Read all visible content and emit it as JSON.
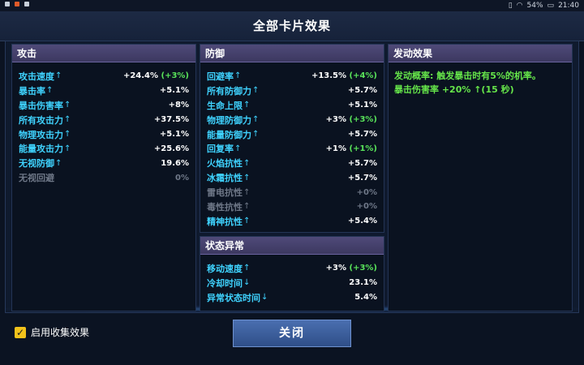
{
  "status_bar": {
    "right_text": "54%",
    "time": "21:40"
  },
  "dialog_title": "全部卡片效果",
  "attack": {
    "header": "攻击",
    "rows": [
      {
        "label": "攻击速度",
        "arrow": "↑",
        "value": "+24.4%",
        "bonus": "(+3%)"
      },
      {
        "label": "暴击率",
        "arrow": "↑",
        "value": "+5.1%",
        "bonus": ""
      },
      {
        "label": "暴击伤害率",
        "arrow": "↑",
        "value": "+8%",
        "bonus": ""
      },
      {
        "label": "所有攻击力",
        "arrow": "↑",
        "value": "+37.5%",
        "bonus": ""
      },
      {
        "label": "物理攻击力",
        "arrow": "↑",
        "value": "+5.1%",
        "bonus": ""
      },
      {
        "label": "能量攻击力",
        "arrow": "↑",
        "value": "+25.6%",
        "bonus": ""
      },
      {
        "label": "无视防御",
        "arrow": "↑",
        "value": "19.6%",
        "bonus": ""
      },
      {
        "label": "无视回避",
        "arrow": "",
        "value": "0%",
        "bonus": "",
        "dim": true
      }
    ]
  },
  "defense": {
    "header": "防御",
    "rows": [
      {
        "label": "回避率",
        "arrow": "↑",
        "value": "+13.5%",
        "bonus": "(+4%)"
      },
      {
        "label": "所有防御力",
        "arrow": "↑",
        "value": "+5.7%",
        "bonus": ""
      },
      {
        "label": "生命上限",
        "arrow": "↑",
        "value": "+5.1%",
        "bonus": ""
      },
      {
        "label": "物理防御力",
        "arrow": "↑",
        "value": "+3%",
        "bonus": "(+3%)"
      },
      {
        "label": "能量防御力",
        "arrow": "↑",
        "value": "+5.7%",
        "bonus": ""
      },
      {
        "label": "回复率",
        "arrow": "↑",
        "value": "+1%",
        "bonus": "(+1%)"
      },
      {
        "label": "火焰抗性",
        "arrow": "↑",
        "value": "+5.7%",
        "bonus": ""
      },
      {
        "label": "冰霜抗性",
        "arrow": "↑",
        "value": "+5.7%",
        "bonus": ""
      },
      {
        "label": "雷电抗性",
        "arrow": "↑",
        "value": "+0%",
        "bonus": "",
        "dim": true
      },
      {
        "label": "毒性抗性",
        "arrow": "↑",
        "value": "+0%",
        "bonus": "",
        "dim": true
      },
      {
        "label": "精神抗性",
        "arrow": "↑",
        "value": "+5.4%",
        "bonus": ""
      }
    ]
  },
  "status_effects": {
    "header": "状态异常",
    "rows": [
      {
        "label": "移动速度",
        "arrow": "↑",
        "value": "+3%",
        "bonus": "(+3%)"
      },
      {
        "label": "冷却时间",
        "arrow": "↓",
        "value": "23.1%",
        "bonus": ""
      },
      {
        "label": "异常状态时间",
        "arrow": "↓",
        "value": "5.4%",
        "bonus": ""
      }
    ]
  },
  "trigger": {
    "header": "发动效果",
    "line1": "发动概率: 触发暴击时有5%的机率。",
    "line2": "暴击伤害率 +20% ↑(15 秒)"
  },
  "footer": {
    "checkbox_label": "启用收集效果",
    "checkbox_checked": true,
    "close_label": "关闭"
  },
  "colors": {
    "stat_label": "#3fd3ff",
    "bonus_green": "#59e35a",
    "effect_green": "#66e64a",
    "panel_header": "#4f4a79",
    "checkbox": "#f2c21b"
  }
}
